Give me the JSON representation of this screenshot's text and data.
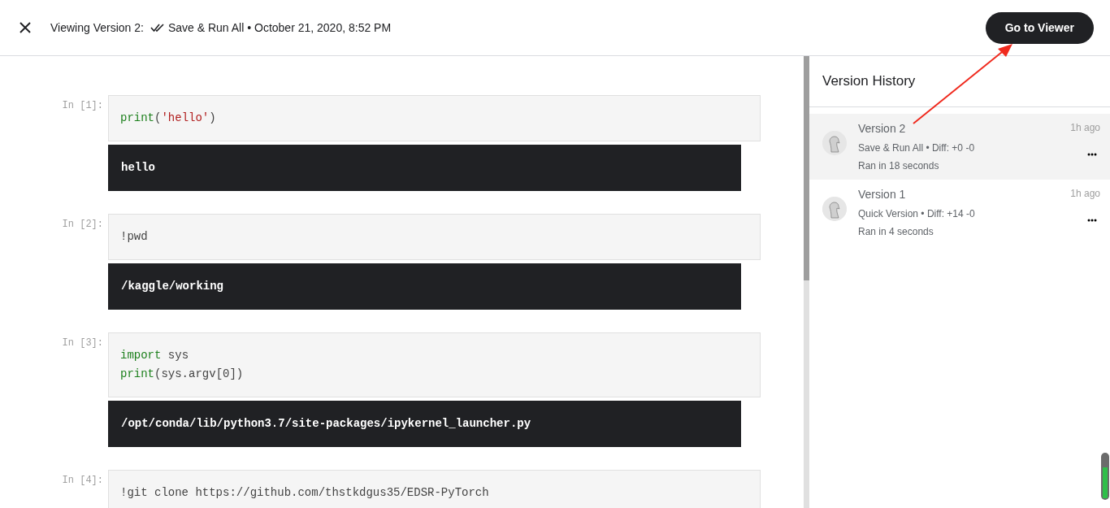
{
  "header": {
    "title": "Viewing Version 2:",
    "version_type": "Save & Run All",
    "separator": "•",
    "date": "October 21, 2020, 8:52 PM",
    "button": "Go to Viewer"
  },
  "cells": [
    {
      "prompt": "In [1]:",
      "code": [
        [
          {
            "kind": "builtin",
            "text": "print"
          },
          {
            "kind": "plain",
            "text": "("
          },
          {
            "kind": "string",
            "text": "'hello'"
          },
          {
            "kind": "plain",
            "text": ")"
          }
        ]
      ],
      "output": "hello"
    },
    {
      "prompt": "In [2]:",
      "code": [
        [
          {
            "kind": "plain",
            "text": "!pwd"
          }
        ]
      ],
      "output": "/kaggle/working"
    },
    {
      "prompt": "In [3]:",
      "code": [
        [
          {
            "kind": "keyword",
            "text": "import"
          },
          {
            "kind": "plain",
            "text": " sys"
          }
        ],
        [
          {
            "kind": "builtin",
            "text": "print"
          },
          {
            "kind": "plain",
            "text": "(sys.argv[0])"
          }
        ]
      ],
      "output": "/opt/conda/lib/python3.7/site-packages/ipykernel_launcher.py"
    },
    {
      "prompt": "In [4]:",
      "code": [
        [
          {
            "kind": "plain",
            "text": "!git clone https://github.com/thstkdgus35/EDSR-PyTorch"
          }
        ]
      ]
    }
  ],
  "sidebar": {
    "title": "Version History",
    "versions": [
      {
        "name": "Version 2",
        "time": "1h ago",
        "details": "Save & Run All • Diff: +0 -0",
        "runtime": "Ran in 18 seconds",
        "selected": true
      },
      {
        "name": "Version 1",
        "time": "1h ago",
        "details": "Quick Version • Diff: +14 -0",
        "runtime": "Ran in 4 seconds",
        "selected": false
      }
    ]
  }
}
